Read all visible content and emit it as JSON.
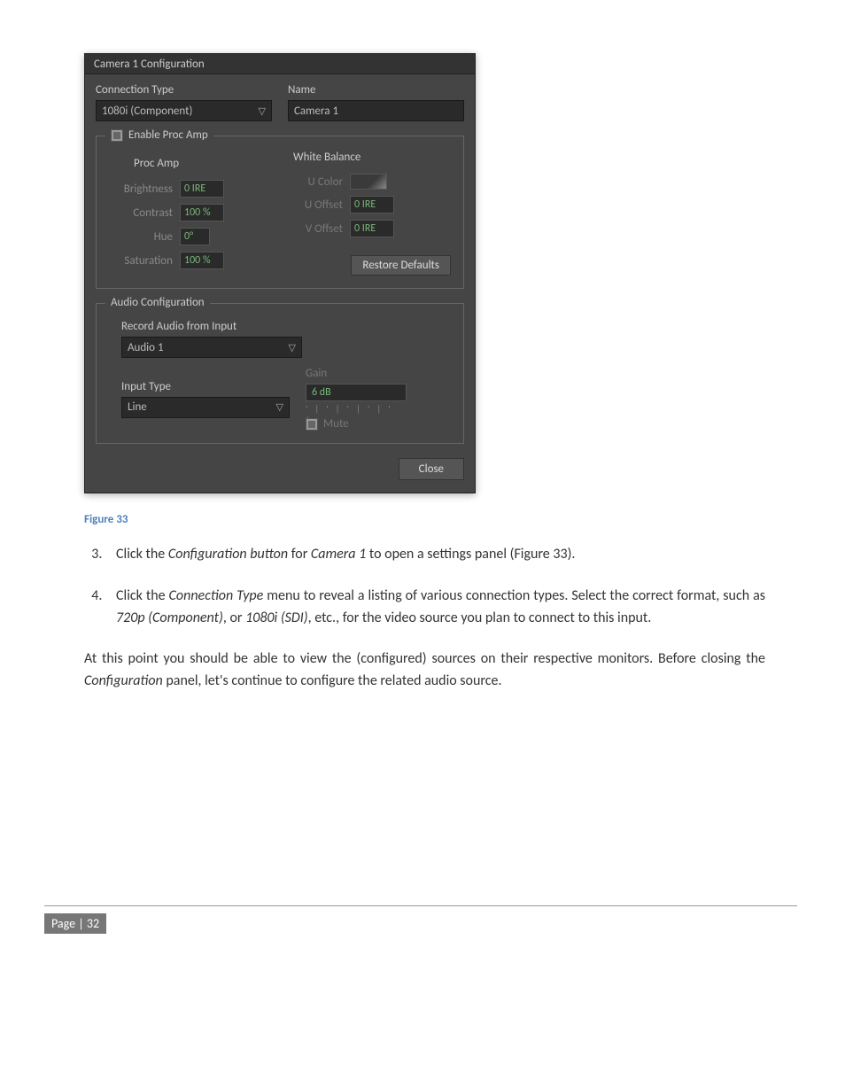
{
  "dialog": {
    "title": "Camera 1 Configuration",
    "connection_type_label": "Connection Type",
    "connection_type_value": "1080i (Component)",
    "name_label": "Name",
    "name_value": "Camera 1",
    "proc_amp": {
      "enable_label": "Enable Proc Amp",
      "heading": "Proc Amp",
      "brightness_label": "Brightness",
      "brightness_value": "0  IRE",
      "contrast_label": "Contrast",
      "contrast_value": "100  %",
      "hue_label": "Hue",
      "hue_value": "0°",
      "saturation_label": "Saturation",
      "saturation_value": "100  %",
      "wb_heading": "White Balance",
      "u_color_label": "U   Color",
      "u_offset_label": "U Offset",
      "u_offset_value": "0  IRE",
      "v_offset_label": "V Offset",
      "v_offset_value": "0  IRE",
      "restore_label": "Restore Defaults"
    },
    "audio": {
      "heading": "Audio Configuration",
      "record_label": "Record Audio from Input",
      "record_value": "Audio 1",
      "input_type_label": "Input Type",
      "input_type_value": "Line",
      "gain_label": "Gain",
      "gain_value": "6 dB",
      "mute_label": "Mute"
    },
    "close_label": "Close"
  },
  "caption": "Figure 33",
  "step3": "Click the Configuration button for Camera 1 to open a settings panel (Figure 33).",
  "step3_parts": {
    "pre": "Click the ",
    "i1": "Configuration button",
    "mid": " for ",
    "i2": "Camera 1",
    "post": " to open a settings panel (Figure 33)."
  },
  "step4_parts": {
    "pre": "Click the ",
    "i1": "Connection Type",
    "mid1": " menu to reveal a listing of various connection types.  Select the correct format, such as ",
    "i2": "720p (Component)",
    "mid2": ", or ",
    "i3": "1080i (SDI)",
    "post": ", etc., for the video source you plan to connect to this input."
  },
  "para_parts": {
    "pre": "At this point you should be able to view the (configured) sources on their respective monitors. Before closing the ",
    "i1": "Configuration",
    "post": " panel, let's continue to configure the related audio source."
  },
  "page_num": "Page | 32"
}
